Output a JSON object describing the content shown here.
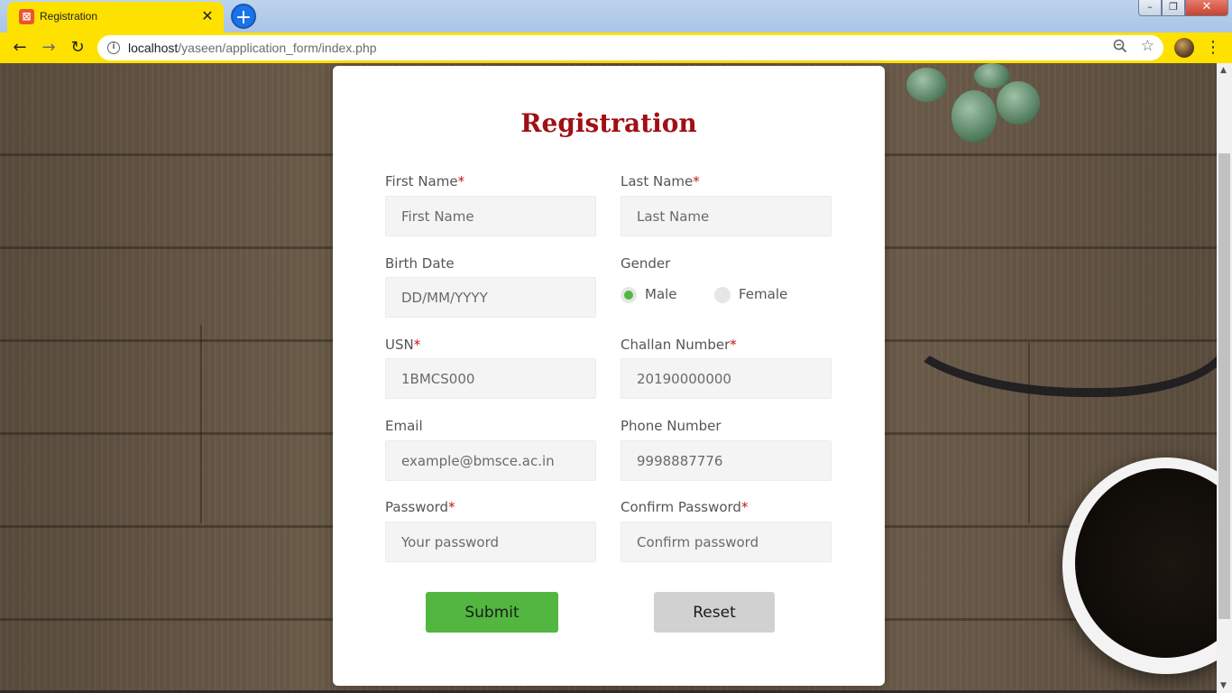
{
  "browser": {
    "tab_title": "Registration",
    "tab_close": "✕",
    "new_tab": "+",
    "url_host": "localhost",
    "url_path": "/yaseen/application_form/index.php",
    "back": "←",
    "forward": "→",
    "reload": "↻",
    "menu": "⋮",
    "win_min": "–",
    "win_max": "❐",
    "win_close": "✕"
  },
  "form": {
    "title": "Registration",
    "required_mark": "*",
    "first_name": {
      "label": "First Name",
      "placeholder": "First Name",
      "value": ""
    },
    "last_name": {
      "label": "Last Name",
      "placeholder": "Last Name",
      "value": ""
    },
    "birth_date": {
      "label": "Birth Date",
      "placeholder": "DD/MM/YYYY",
      "value": ""
    },
    "gender": {
      "label": "Gender",
      "options": [
        "Male",
        "Female"
      ],
      "selected": "Male"
    },
    "usn": {
      "label": "USN",
      "placeholder": "1BMCS000",
      "value": ""
    },
    "challan": {
      "label": "Challan Number",
      "placeholder": "20190000000",
      "value": ""
    },
    "email": {
      "label": "Email",
      "placeholder": "example@bmsce.ac.in",
      "value": ""
    },
    "phone": {
      "label": "Phone Number",
      "placeholder": "9998887776",
      "value": ""
    },
    "password": {
      "label": "Password",
      "placeholder": "Your password",
      "value": ""
    },
    "confirm_password": {
      "label": "Confirm Password",
      "placeholder": "Confirm password",
      "value": ""
    },
    "submit_label": "Submit",
    "reset_label": "Reset"
  },
  "colors": {
    "chrome_accent": "#ffe100",
    "title_color": "#a00f14",
    "submit_bg": "#52b640",
    "reset_bg": "#d1d1d1",
    "required_color": "#c4151c"
  }
}
